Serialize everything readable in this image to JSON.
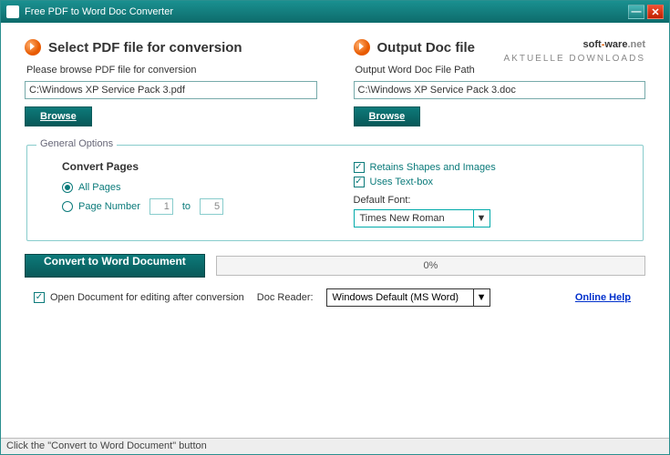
{
  "title": "Free PDF to Word Doc Converter",
  "watermark": {
    "brand_soft": "soft",
    "brand_dash": "-",
    "brand_ware": "ware",
    "brand_dot": ".",
    "brand_net": "net",
    "subtitle": "AKTUELLE DOWNLOADS"
  },
  "left": {
    "heading": "Select PDF file for conversion",
    "label": "Please browse PDF file for conversion",
    "path": "C:\\Windows XP Service Pack 3.pdf",
    "browse": "Browse"
  },
  "right": {
    "heading": "Output Doc file",
    "label": "Output Word Doc File Path",
    "path": "C:\\Windows XP Service Pack 3.doc",
    "browse": "Browse"
  },
  "options": {
    "legend": "General Options",
    "convert_pages": "Convert Pages",
    "all_pages": "All Pages",
    "page_number": "Page Number",
    "page_from": "1",
    "to_label": "to",
    "page_to": "5",
    "retain": "Retains Shapes and Images",
    "textbox": "Uses Text-box",
    "default_font_label": "Default Font:",
    "default_font": "Times New Roman"
  },
  "convert_button": "Convert to Word Document",
  "progress": "0%",
  "open_after": "Open Document for editing after conversion",
  "doc_reader_label": "Doc Reader:",
  "doc_reader": "Windows Default (MS Word)",
  "help": "Online Help",
  "status": "Click the \"Convert to Word Document\" button"
}
